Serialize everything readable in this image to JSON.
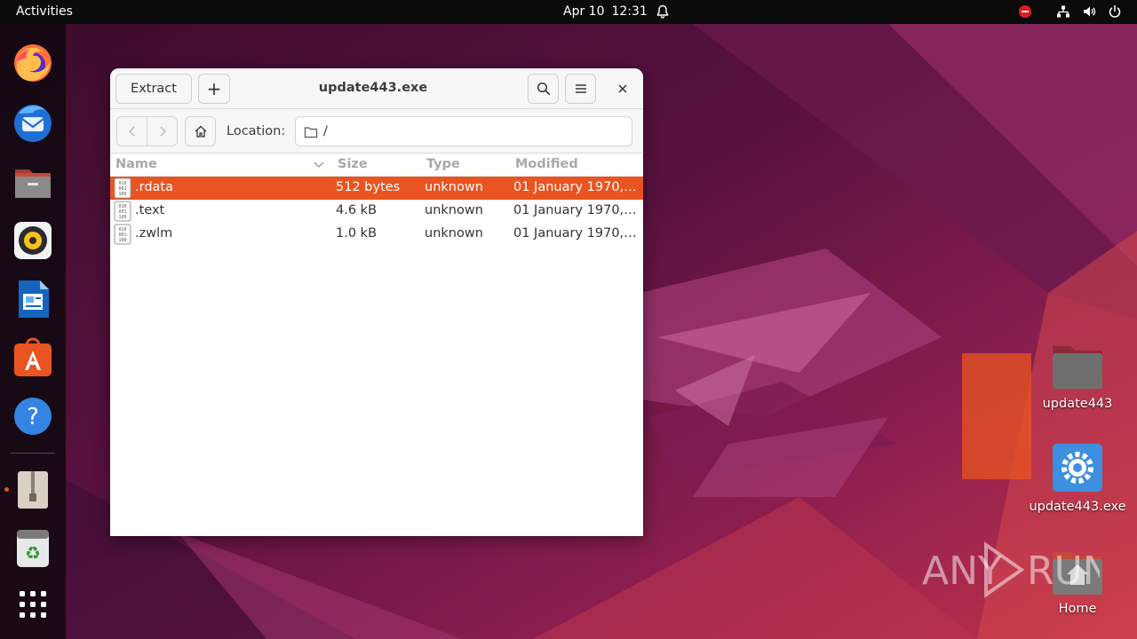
{
  "topbar": {
    "activities": "Activities",
    "date": "Apr 10",
    "time": "12:31"
  },
  "dock": {
    "items": [
      "firefox-icon",
      "thunderbird-icon",
      "files-icon",
      "rhythmbox-icon",
      "libreoffice-writer-icon",
      "app-center-icon",
      "help-icon",
      "archive-manager-icon",
      "trash-icon",
      "show-apps-icon"
    ],
    "running": "archive-manager-icon"
  },
  "window": {
    "title": "update443.exe",
    "extract_label": "Extract",
    "add_label": "+",
    "location_label": "Location:",
    "location_path": "/",
    "columns": [
      "Name",
      "Size",
      "Type",
      "Modified"
    ],
    "files": [
      {
        "name": ".rdata",
        "size": "512 bytes",
        "type": "unknown",
        "modified": "01 January 1970,…"
      },
      {
        "name": ".text",
        "size": "4.6 kB",
        "type": "unknown",
        "modified": "01 January 1970,…"
      },
      {
        "name": ".zwlm",
        "size": "1.0 kB",
        "type": "unknown",
        "modified": "01 January 1970,…"
      }
    ],
    "selected_index": 0
  },
  "desktop": {
    "icons": [
      {
        "label": "update443",
        "icon": "folder-icon"
      },
      {
        "label": "update443.exe",
        "icon": "executable-gear-icon"
      },
      {
        "label": "Home",
        "icon": "home-folder-icon"
      }
    ]
  },
  "watermark": "ANY RUN",
  "colors": {
    "accent": "#e95420",
    "topbar": "#0b0b0b"
  }
}
